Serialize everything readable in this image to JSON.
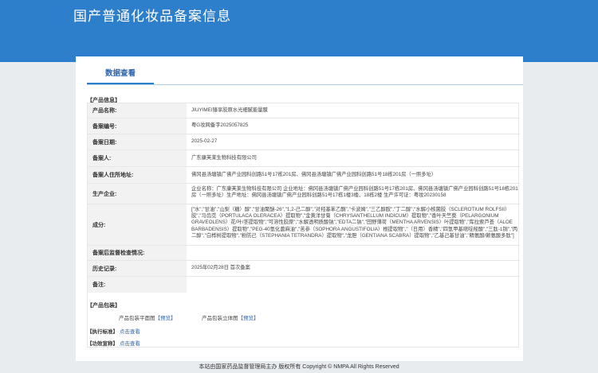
{
  "header": {
    "title": "国产普通化妆品备案信息"
  },
  "tabs": [
    {
      "label": "数据查看"
    }
  ],
  "sections": {
    "product_info": "【产品信息】",
    "packaging": "【产品包装】",
    "standard": "【执行标准】",
    "efficacy": "【功效宣称】"
  },
  "table": [
    {
      "label": "产品名称:",
      "value": "JIUYIMEI臻享胶原水光细腻能量膜"
    },
    {
      "label": "备案编号:",
      "value": "粤G妆网备字2025057825"
    },
    {
      "label": "备案日期:",
      "value": "2025-02-27"
    },
    {
      "label": "备案人:",
      "value": "广东康芙莱生物科技有限公司"
    },
    {
      "label": "备案人住所地址:",
      "value": "佛冈县汤塘镇广佛产业园科创路51号17栋201房、佛冈县汤塘镇广佛产业园科创路51号18栋201房（一照多址）"
    },
    {
      "label": "生产企业:",
      "value": "企业名称：广东康芙莱生物科技有限公司 企业地址：佛冈县汤塘镇广佛产业园科创路51号17栋201房、佛冈县汤塘镇广佛产业园科创路51号18栋201房（一照多址）生产地址：佛冈县汤塘镇广佛产业园科创路51号17栋1楼3楼、18栋2楼 生产许可证：粤妆20230158"
    },
    {
      "label": "成分:",
      "value": "[\"水\",\"甘油\",\"山梨（糖）醇\",\"甘油聚醚-26\",\"1,2-己二醇\",\"对羟基苯乙酮\",\"卡波姆\",\"三乙醇胺\",\"丁二醇\",\"水解小核菌胶（SCLEROTIUM ROLFSII）胶\",\"马齿苋（PORTULACA OLERACEA）提取物\",\"金黄洋甘菊（CHRYSANTHELLUM INDICUM）提取物\",\"香叶天竺葵（PELARGONIUM GRAVEOLENS）花/叶/茎提取物\",\"可溶性胶原\",\"水解透明质酸钠\",\"EDTA二钠\",\"田野薄荷（MENTHA ARVENSIS）叶提取物\",\"库拉索芦荟（ALOE BARBADENSIS）提取物\",\"PEG-40氢化蓖麻油\",\"苦参（SOPHORA ANGUSTIFOLIA）根提取物\",\"（日用）香精\",\"四氢甲基嘧啶羧酸\",\"三肽-1铜\",\"丙二醇\",\"白桦树提取物\",\"粉防己（STEPHANIA TETRANDRA）提取物\",\"龙胆（GENTIANA SCABRA）提取物\",\"乙基己基甘油\",\"精氨酸/赖氨酸多肽\"]"
    },
    {
      "label": "备案后监督检查情况:",
      "value": ""
    },
    {
      "label": "历史记录:",
      "value": "2025年02月28日 首次备案"
    },
    {
      "label": "备注:",
      "value": ""
    }
  ],
  "packaging": {
    "flat_label": "产品包装平面图",
    "flat_link": "【预览】",
    "solid_label": "产品包装立体图",
    "solid_link": "【预览】"
  },
  "standard_link": "点击查看",
  "efficacy_link": "点击查看",
  "footer": "本站由国家药品监督管理局主办 版权所有 Copyright © NMPA All Rights Reserved"
}
